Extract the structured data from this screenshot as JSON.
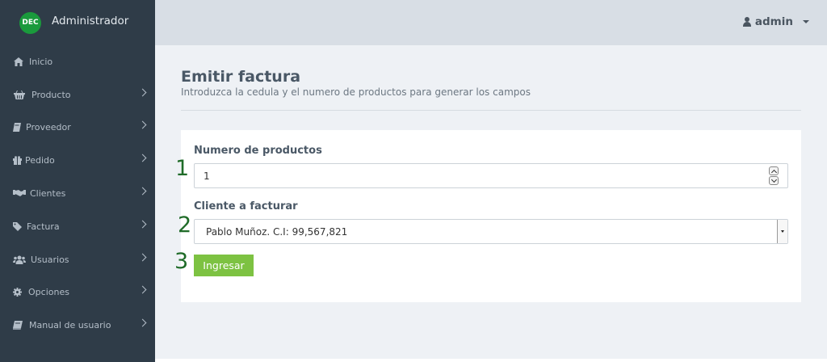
{
  "sidebar": {
    "logo_text": "DEC",
    "brand_title": "Administrador",
    "items": [
      {
        "label": "Inicio",
        "icon": "home-icon",
        "has_submenu": false
      },
      {
        "label": "Producto",
        "icon": "basket-icon",
        "has_submenu": true
      },
      {
        "label": "Proveedor",
        "icon": "book-icon",
        "has_submenu": true
      },
      {
        "label": "Pedido",
        "icon": "gift-icon",
        "has_submenu": true
      },
      {
        "label": "Clientes",
        "icon": "handshake-icon",
        "has_submenu": true
      },
      {
        "label": "Factura",
        "icon": "tag-icon",
        "has_submenu": true
      },
      {
        "label": "Usuarios",
        "icon": "users-icon",
        "has_submenu": true
      },
      {
        "label": "Opciones",
        "icon": "gear-icon",
        "has_submenu": true
      },
      {
        "label": "Manual de usuario",
        "icon": "manual-book-icon",
        "has_submenu": true
      }
    ]
  },
  "header": {
    "user_name": "admin"
  },
  "main": {
    "title": "Emitir factura",
    "subtitle": "Introduzca la cedula y el numero de productos para generar los campos",
    "form": {
      "quantity_label": "Numero de productos",
      "quantity_value": "1",
      "client_label": "Cliente a facturar",
      "client_selected": "Pablo Muñoz. C.I: 99,567,821",
      "submit_label": "Ingresar"
    },
    "step_markers": [
      "1",
      "2",
      "3"
    ]
  },
  "colors": {
    "sidebar_bg": "#2f3c48",
    "topbar_bg": "#d8dee5",
    "content_bg": "#eef1f5",
    "button_green": "#7dc242",
    "logo_green": "#1a9a3c",
    "step_marker": "#1f6b28"
  }
}
